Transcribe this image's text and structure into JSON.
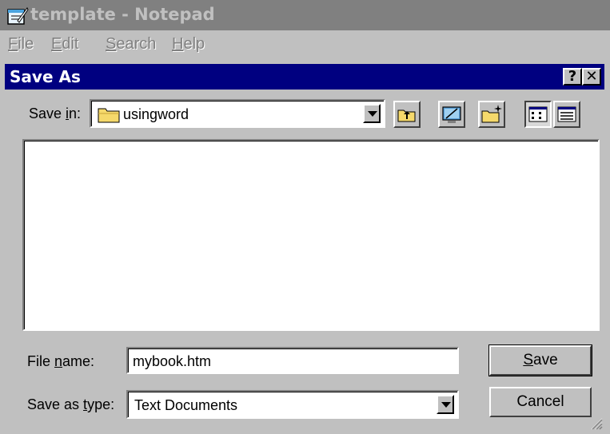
{
  "notepad": {
    "title": "template - Notepad",
    "menu": {
      "file": {
        "pre": "",
        "key": "F",
        "post": "ile"
      },
      "edit": {
        "pre": "",
        "key": "E",
        "post": "dit"
      },
      "search": {
        "pre": "",
        "key": "S",
        "post": "earch"
      },
      "help": {
        "pre": "",
        "key": "H",
        "post": "elp"
      }
    }
  },
  "dialog": {
    "title": "Save As",
    "help_btn": "?",
    "close_btn": "✕",
    "save_in": {
      "pre": "Save ",
      "key": "i",
      "post": "n:",
      "value": "usingword"
    },
    "file_name": {
      "pre": "File ",
      "key": "n",
      "post": "ame:",
      "value": "mybook.htm"
    },
    "save_type": {
      "pre": "Save as ",
      "key": "t",
      "post": "ype:",
      "value": "Text Documents"
    },
    "save_button": {
      "pre": "",
      "key": "S",
      "post": "ave"
    },
    "cancel_button": "Cancel"
  },
  "icons": {
    "notepad": "notepad-icon",
    "folder": "folder-icon",
    "up": "up-one-level-icon",
    "desktop": "desktop-icon",
    "new_folder": "new-folder-icon",
    "list": "list-view-icon",
    "details": "details-view-icon"
  }
}
